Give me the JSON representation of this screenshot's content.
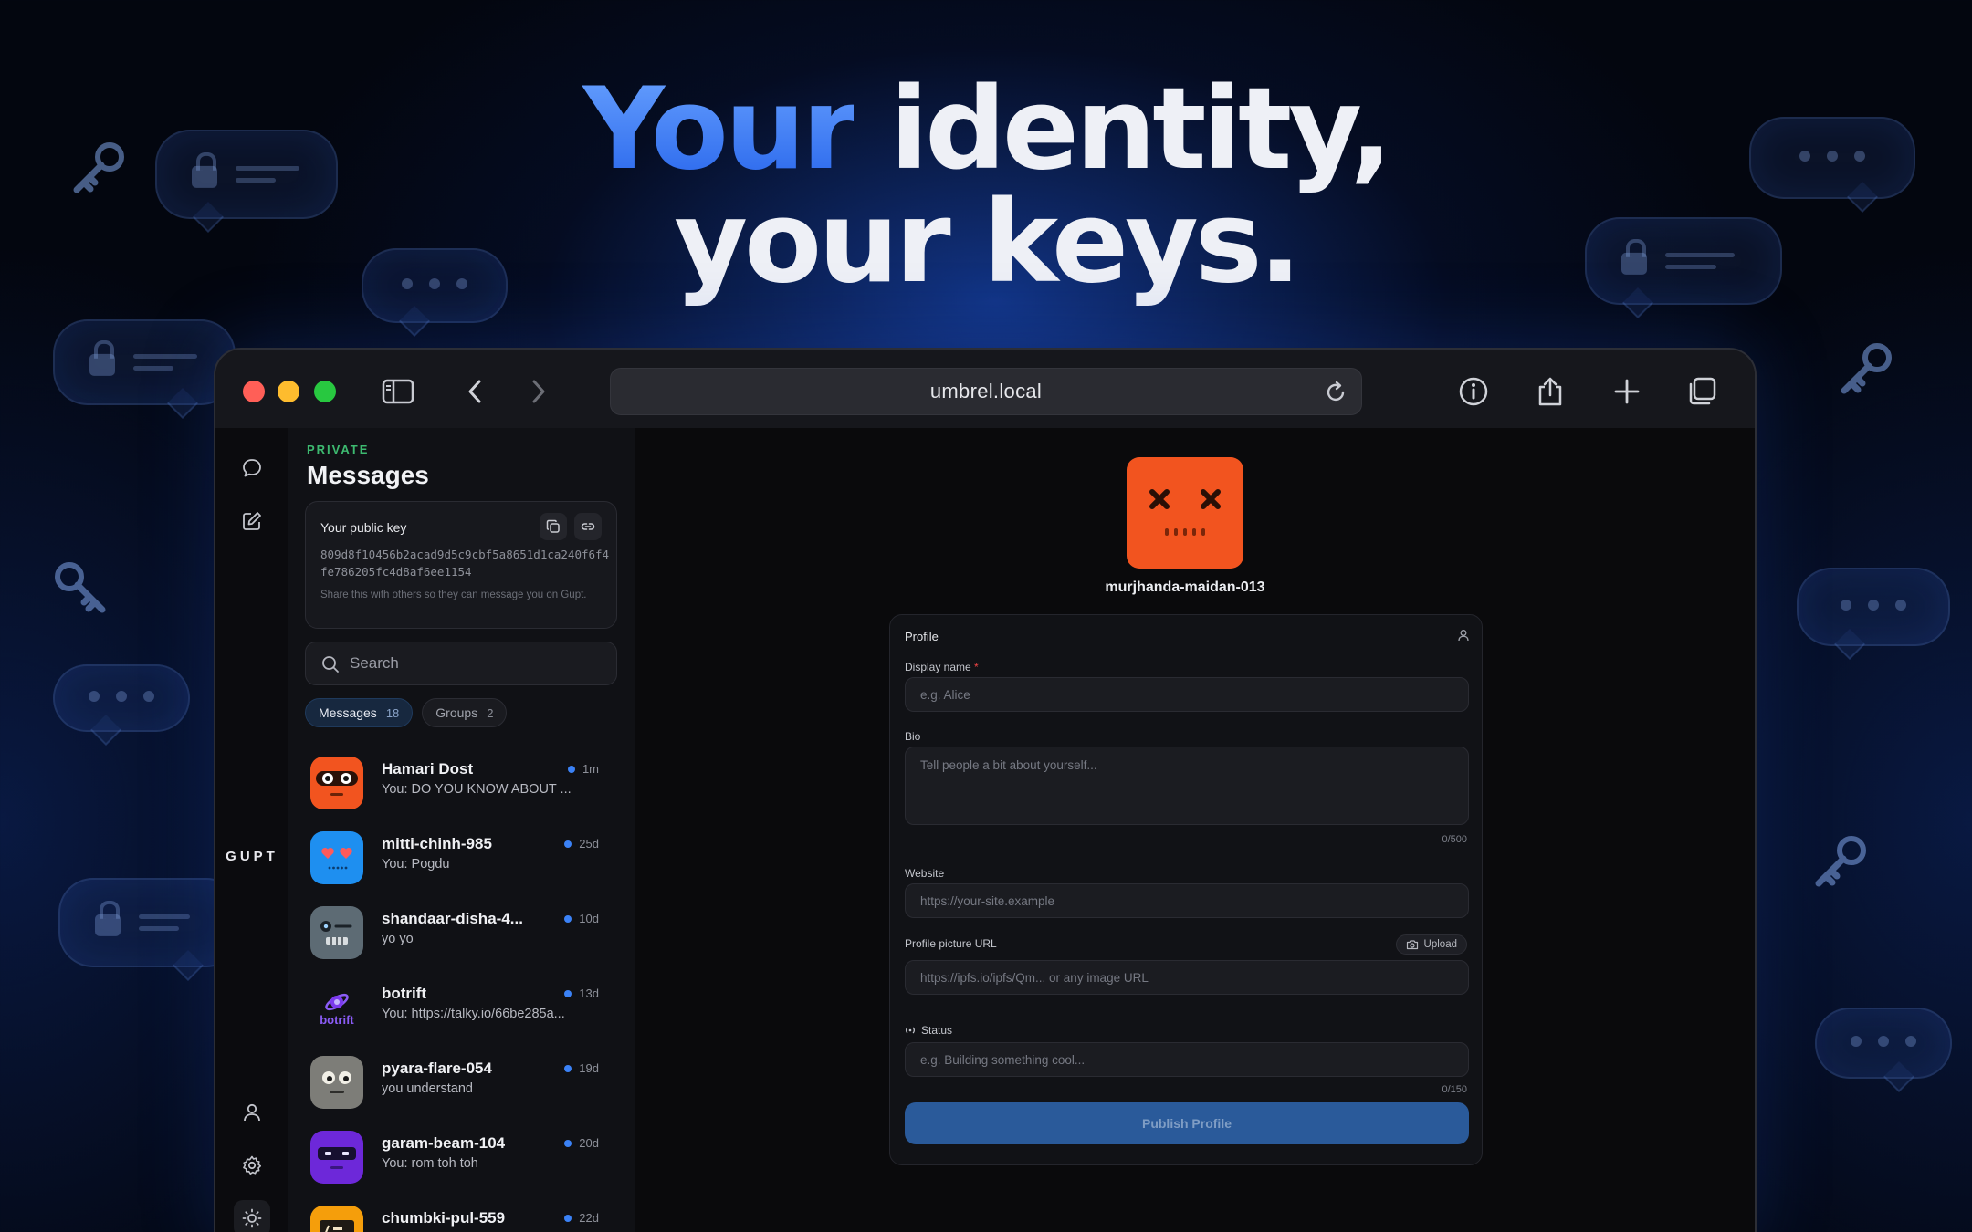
{
  "headline": {
    "accent": "Your",
    "rest_line1": "identity,",
    "line2": "your keys."
  },
  "browser": {
    "url": "umbrel.local",
    "traffic_colors": [
      "#ff5f57",
      "#febc2e",
      "#28c840"
    ]
  },
  "rail": {
    "brand": "GUPT",
    "icons": [
      "chat-bubble-icon",
      "compose-icon",
      "user-icon",
      "gear-icon",
      "sun-icon"
    ]
  },
  "sidebar": {
    "eyebrow": "PRIVATE",
    "title": "Messages",
    "public_key": {
      "label": "Your public key",
      "value": "809d8f10456b2acad9d5c9cbf5a8651d1ca240f6f4fe786205fc4d8af6ee1154",
      "hint": "Share this with others so they can message you on Gupt."
    },
    "search_placeholder": "Search",
    "tabs": [
      {
        "label": "Messages",
        "count": "18",
        "active": true
      },
      {
        "label": "Groups",
        "count": "2",
        "active": false
      }
    ],
    "conversations": [
      {
        "name": "Hamari Dost",
        "preview": "You: DO YOU KNOW ABOUT ...",
        "time": "1m",
        "avatar": "orange-mask"
      },
      {
        "name": "mitti-chinh-985",
        "preview": "You: Pogdu",
        "time": "25d",
        "avatar": "blue-hearts"
      },
      {
        "name": "shandaar-disha-4...",
        "preview": "yo yo",
        "time": "10d",
        "avatar": "slate-robot"
      },
      {
        "name": "botrift",
        "preview": "You: https://talky.io/66be285a...",
        "time": "13d",
        "avatar": "botrift-logo",
        "logo_text": "botrift"
      },
      {
        "name": "pyara-flare-054",
        "preview": "you understand",
        "time": "19d",
        "avatar": "gray-eyes"
      },
      {
        "name": "garam-beam-104",
        "preview": "You: rom toh toh",
        "time": "20d",
        "avatar": "purple-visor"
      },
      {
        "name": "chumbki-pul-559",
        "preview": "",
        "time": "22d",
        "avatar": "amber-box"
      }
    ]
  },
  "profile": {
    "username": "murjhanda-maidan-013",
    "card_title": "Profile",
    "display_name_label": "Display name",
    "display_name_required": "*",
    "display_name_placeholder": "e.g. Alice",
    "bio_label": "Bio",
    "bio_placeholder": "Tell people a bit about yourself...",
    "bio_counter": "0/500",
    "website_label": "Website",
    "website_placeholder": "https://your-site.example",
    "picture_label": "Profile picture URL",
    "upload_label": "Upload",
    "picture_placeholder": "https://ipfs.io/ipfs/Qm... or any image URL",
    "status_label": "Status",
    "status_placeholder": "e.g. Building something cool...",
    "status_counter": "0/150",
    "publish_label": "Publish Profile"
  }
}
